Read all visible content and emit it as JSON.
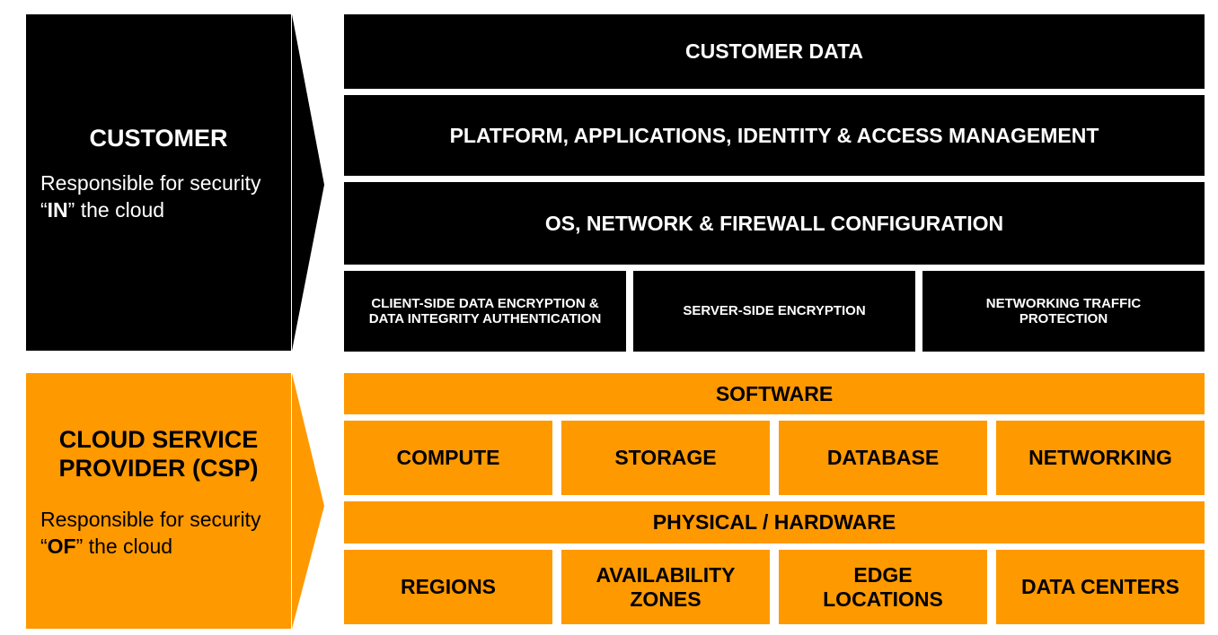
{
  "colors": {
    "customer": "#000000",
    "csp": "#FF9900"
  },
  "customer": {
    "title": "CUSTOMER",
    "desc_pre": "Responsible for security “",
    "desc_bold": "IN",
    "desc_post": "” the cloud"
  },
  "csp": {
    "title": "CLOUD SERVICE PROVIDER (CSP)",
    "desc_pre": "Responsible for security “",
    "desc_bold": "OF",
    "desc_post": "” the cloud"
  },
  "customer_layers": [
    "CUSTOMER DATA",
    "PLATFORM, APPLICATIONS, IDENTITY & ACCESS MANAGEMENT",
    "OS, NETWORK & FIREWALL CONFIGURATION"
  ],
  "customer_encryption": [
    "CLIENT-SIDE DATA ENCRYPTION & DATA INTEGRITY AUTHENTICATION",
    "SERVER-SIDE ENCRYPTION",
    "NETWORKING TRAFFIC PROTECTION"
  ],
  "csp_software": "SOFTWARE",
  "csp_services": [
    "COMPUTE",
    "STORAGE",
    "DATABASE",
    "NETWORKING"
  ],
  "csp_hardware": "PHYSICAL / HARDWARE",
  "csp_infrastructure": [
    "REGIONS",
    "AVAILABILITY ZONES",
    "EDGE LOCATIONS",
    "DATA CENTERS"
  ]
}
